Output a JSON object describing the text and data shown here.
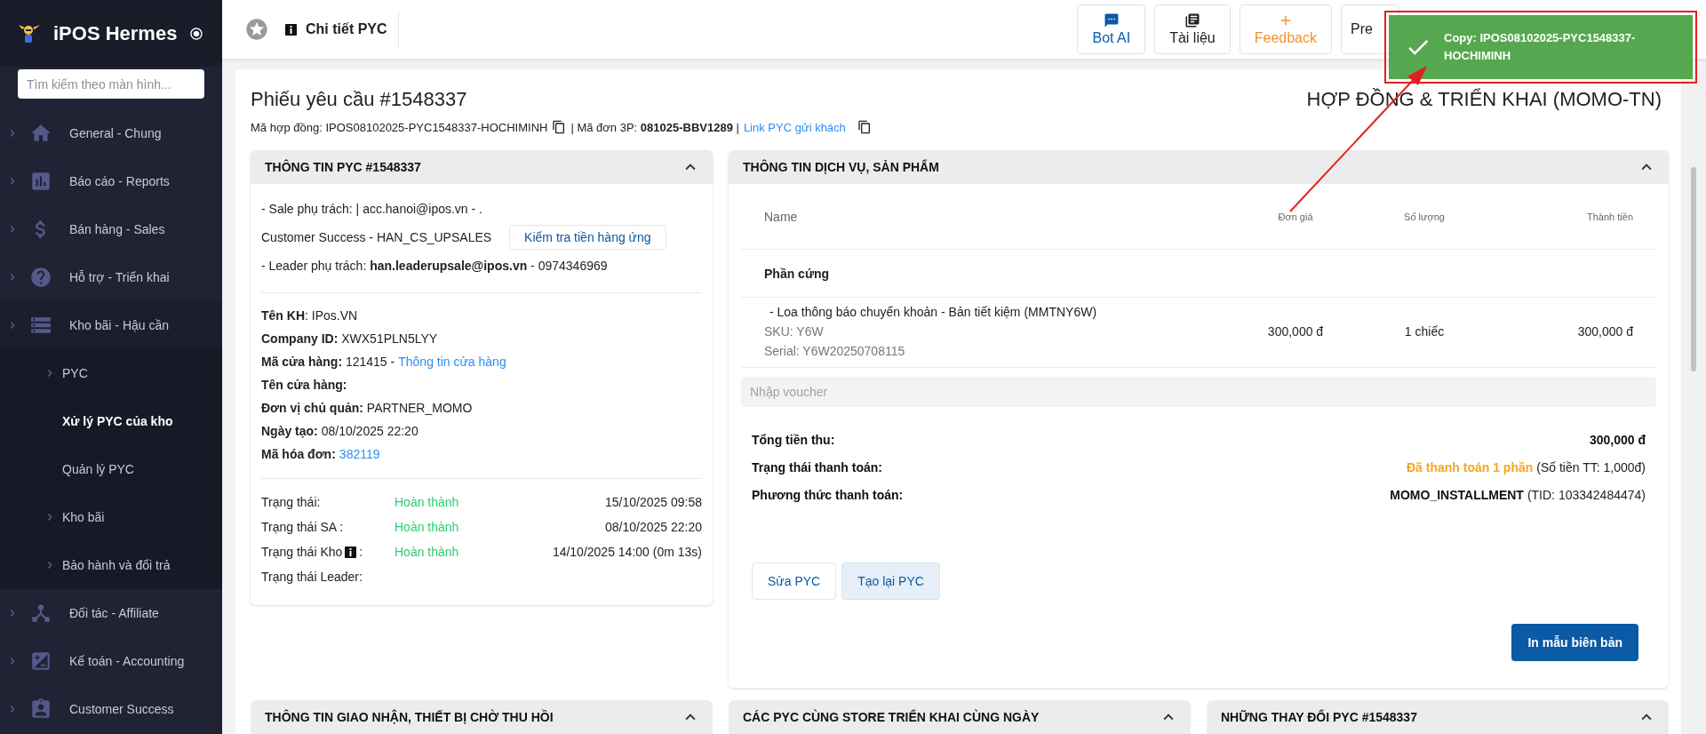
{
  "sidebar": {
    "title": "iPOS Hermes",
    "search": {
      "placeholder": "Tìm kiếm theo màn hình..."
    },
    "items": [
      {
        "label": "General - Chung",
        "expandable": true
      },
      {
        "label": "Báo cáo - Reports",
        "expandable": true
      },
      {
        "label": "Bán hàng - Sales",
        "expandable": true
      },
      {
        "label": "Hỗ trợ - Triển khai",
        "expandable": true
      },
      {
        "label": "Kho bãi - Hậu cần",
        "expandable": true,
        "expanded": true,
        "children": [
          {
            "label": "PYC",
            "expandable": true,
            "selected": false
          },
          {
            "label": "Xử lý PYC của kho",
            "expandable": false,
            "selected": true
          },
          {
            "label": "Quản lý PYC",
            "expandable": false,
            "selected": false
          },
          {
            "label": "Kho bãi",
            "expandable": true,
            "selected": false
          },
          {
            "label": "Bảo hành và đổi trả",
            "expandable": true,
            "selected": false
          }
        ]
      },
      {
        "label": "Đối tác - Affiliate",
        "expandable": true
      },
      {
        "label": "Kế toán - Accounting",
        "expandable": true
      },
      {
        "label": "Customer Success",
        "expandable": true
      }
    ]
  },
  "header": {
    "title": "Chi tiết PYC",
    "buttons": [
      {
        "label": "Bot AI",
        "kind": "chat"
      },
      {
        "label": "Tài liệu",
        "kind": "docs"
      },
      {
        "label": "Feedback",
        "kind": "feedback"
      },
      {
        "label": "Pre",
        "kind": "plain"
      }
    ]
  },
  "toast": {
    "text": "Copy: IPOS08102025-PYC1548337-HOCHIMINH"
  },
  "page": {
    "title": "Phiếu yêu cầu #1548337",
    "type_title": "HỢP ĐỒNG & TRIỂN KHAI (MOMO-TN)",
    "contract_text": "Mã hợp đồng: IPOS08102025-PYC1548337-HOCHIMINH",
    "order_text": "| Mã đơn 3P: **081025-BBV1289** |",
    "customer_link": "Link PYC gửi khách"
  },
  "info_card": {
    "title": "THÔNG TIN PYC #1548337",
    "staff": [
      {
        "text": "- Sale phụ trách: | acc.hanoi@ipos.vn - ."
      },
      {
        "text": "Customer Success - HAN_CS_UPSALES",
        "button": "Kiểm tra tiền hàng ứng"
      },
      {
        "text": "- Leader phụ trách: **han.leaderupsale@ipos.vn** - 0974346969"
      }
    ],
    "fields": [
      {
        "text": "**Tên KH**: IPos.VN"
      },
      {
        "text": "**Company ID:** XWX51PLN5LYY"
      },
      {
        "text": "**Mã cửa hàng:** 121415 -",
        "link": "Thông tin cửa hàng"
      },
      {
        "text": "**Tên cửa hàng:**"
      },
      {
        "text": "**Đơn vị chủ quản:** PARTNER_MOMO"
      },
      {
        "text": "**Ngày tạo:** 08/10/2025 22:20"
      },
      {
        "text": "**Mã hóa đơn:**",
        "link": "382119"
      }
    ],
    "statuses": [
      {
        "label": "Trạng thái:",
        "status": "Hoàn thành",
        "time": "15/10/2025 09:58",
        "info": false
      },
      {
        "label": "Trạng thái SA :",
        "status": "Hoàn thành",
        "time": "08/10/2025 22:20",
        "info": false
      },
      {
        "label": "Trạng thái Kho",
        "suffix": ":",
        "status": "Hoàn thành",
        "time": "14/10/2025 14:00 (0m 13s)",
        "info": true
      },
      {
        "label": "Trạng thái Leader:",
        "info": false
      }
    ]
  },
  "service_card": {
    "title": "THÔNG TIN DỊCH VỤ, SẢN PHẨM",
    "columns": [
      "Name",
      "Đơn giá",
      "Số lượng",
      "Thành tiền"
    ],
    "group": "Phần cứng",
    "rows": [
      {
        "name": "- Loa thông báo chuyển khoản - Bản tiết kiệm (MMTNY6W)",
        "sku": "SKU: Y6W",
        "serial": "Serial: Y6W20250708115",
        "price": "300,000 đ",
        "quantity": "1 chiếc",
        "total": "300,000 đ"
      }
    ],
    "voucher": {
      "placeholder": "Nhập voucher"
    },
    "summary": [
      {
        "label": "Tổng tiền thu:",
        "value": "300,000 đ",
        "kind": "bold"
      },
      {
        "label": "Trạng thái thanh toán:",
        "value": "Đã thanh toán 1 phần",
        "note": "(Số tiền TT: 1,000đ)",
        "kind": "status"
      },
      {
        "label": "Phương thức thanh toán:",
        "value": "MOMO_INSTALLMENT",
        "note": "(TID: 103342484474)",
        "kind": "bold"
      }
    ],
    "actions": [
      {
        "label": "Sửa PYC",
        "selected": false
      },
      {
        "label": "Tạo lại PYC",
        "selected": true
      }
    ],
    "print_button": "In mẫu biên bản"
  },
  "bottom_cards": [
    {
      "title": "THÔNG TIN GIAO NHẬN, THIẾT BỊ CHỜ THU HỒI"
    },
    {
      "title": "CÁC PYC CÙNG STORE TRIỂN KHAI CÙNG NGÀY"
    },
    {
      "title": "NHỮNG THAY ĐỔI PYC #1548337"
    }
  ]
}
